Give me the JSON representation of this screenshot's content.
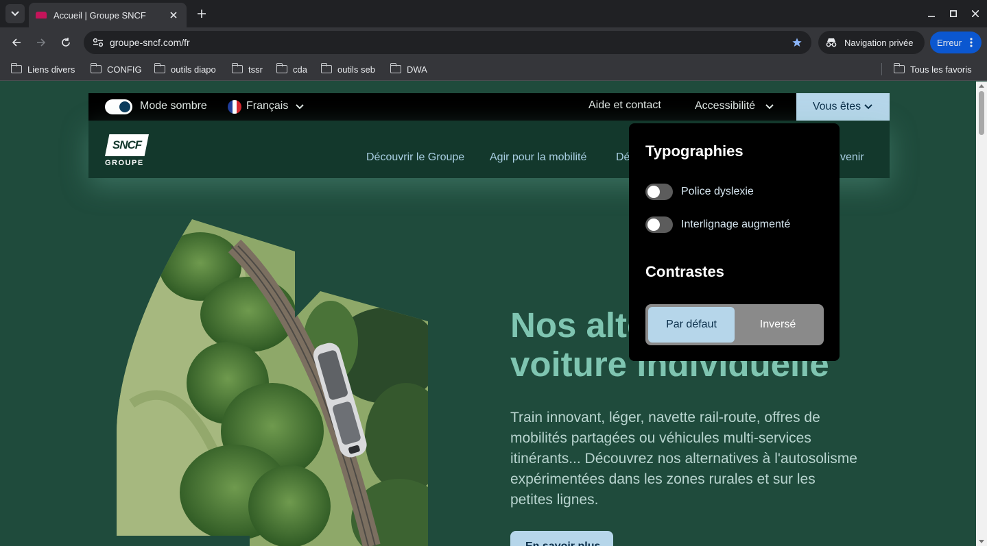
{
  "browser": {
    "tab_title": "Accueil | Groupe SNCF",
    "url": "groupe-sncf.com/fr",
    "incognito_label": "Navigation privée",
    "error_label": "Erreur",
    "bookmarks": [
      "Liens divers",
      "CONFIG",
      "outils diapo",
      "tssr",
      "cda",
      "outils seb",
      "DWA"
    ],
    "all_bookmarks": "Tous les favoris",
    "accent_color": "#0b57d0"
  },
  "topbar": {
    "dark_mode_label": "Mode sombre",
    "language": "Français",
    "help": "Aide et contact",
    "accessibility": "Accessibilité",
    "vous_etes": "Vous êtes"
  },
  "logo": {
    "brand": "SNCF",
    "subtitle": "GROUPE"
  },
  "nav": {
    "items": [
      "Découvrir le Groupe",
      "Agir pour la mobilité",
      "Dé",
      "venir"
    ]
  },
  "hero": {
    "title_line1": "Nos alte",
    "title_line2": "voiture individuelle",
    "text": "Train innovant, léger, navette rail-route, offres de mobilités partagées ou véhicules multi-services itinérants... Découvrez nos alternatives à l'autosolisme expérimentées dans les zones rurales et sur les petites lignes.",
    "button": "En savoir plus"
  },
  "accessibility_menu": {
    "typo_heading": "Typographies",
    "dyslexia_label": "Police dyslexie",
    "line_spacing_label": "Interlignage augmenté",
    "contrast_heading": "Contrastes",
    "contrast_default": "Par défaut",
    "contrast_inverse": "Inversé"
  },
  "colors": {
    "page_bg": "#1f4b3c",
    "hero_title": "#7fc5b1",
    "button_bg": "#b6d6ea"
  }
}
